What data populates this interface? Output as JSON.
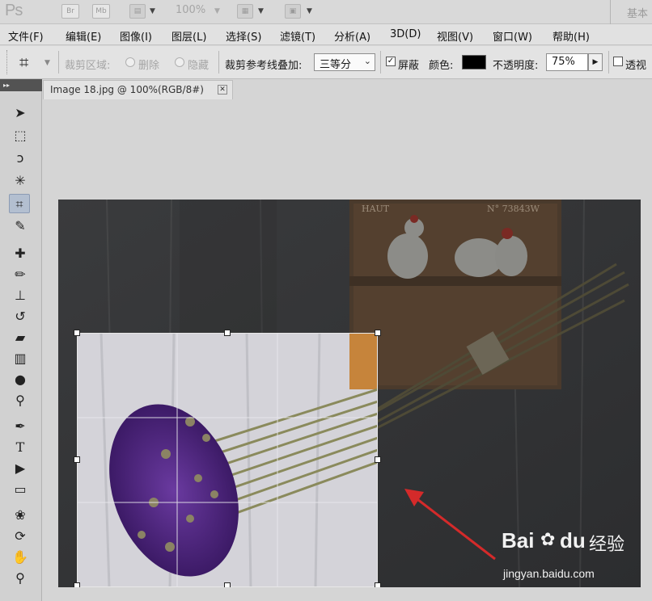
{
  "app": {
    "logo": "Ps",
    "zoom": "100%",
    "bridge_label": "Br",
    "minibridge_label": "Mb",
    "workspace": "基本"
  },
  "menu": [
    "文件(F)",
    "编辑(E)",
    "图像(I)",
    "图层(L)",
    "选择(S)",
    "滤镜(T)",
    "分析(A)",
    "3D(D)",
    "视图(V)",
    "窗口(W)",
    "帮助(H)"
  ],
  "options": {
    "crop_area_label": "裁剪区域:",
    "delete_label": "删除",
    "hide_label": "隐藏",
    "overlay_label": "裁剪参考线叠加:",
    "overlay_value": "三等分",
    "shield_label": "屏蔽",
    "shield_checked": true,
    "color_label": "颜色:",
    "shield_color": "#000000",
    "opacity_label": "不透明度:",
    "opacity_value": "75%",
    "perspective_label": "透视",
    "perspective_checked": false
  },
  "document": {
    "tab_title": "Image 18.jpg @ 100%(RGB/8#)"
  },
  "canvas": {
    "shelf_label_left": "HAUT",
    "shelf_label_right": "N° 73843W",
    "watermark_brand": "Bai",
    "watermark_brand2": "du",
    "watermark_service": "经验",
    "watermark_url": "jingyan.baidu.com"
  },
  "colors": {
    "arrow": "#d42a2a",
    "flower_purple": "#5b2a8c",
    "stems": "#8a8a5a"
  }
}
